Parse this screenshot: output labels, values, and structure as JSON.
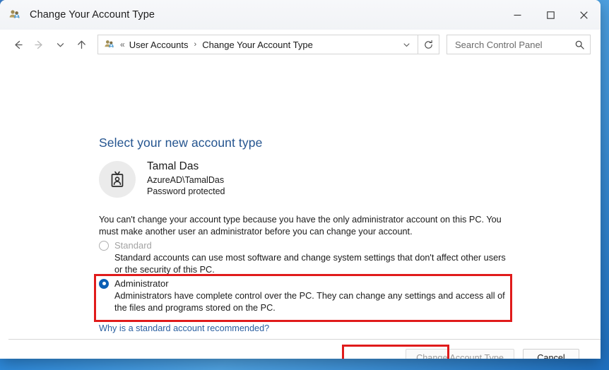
{
  "window": {
    "title": "Change Your Account Type",
    "icon": "user-accounts-icon",
    "controls": {
      "minimize": "─",
      "maximize": "□",
      "close": "✕"
    }
  },
  "navbar": {
    "back_icon": "back-arrow-icon",
    "forward_icon": "forward-arrow-icon",
    "recent_icon": "chevron-down-icon",
    "up_icon": "up-arrow-icon",
    "refresh_icon": "refresh-icon",
    "breadcrumb": {
      "icon": "user-accounts-icon",
      "prefix": "«",
      "items": [
        "User Accounts",
        "Change Your Account Type"
      ],
      "separator": "›"
    },
    "dropdown_icon": "chevron-down-icon"
  },
  "search": {
    "placeholder": "Search Control Panel",
    "value": "",
    "icon": "search-icon"
  },
  "main": {
    "heading": "Select your new account type",
    "account": {
      "avatar_icon": "id-badge-icon",
      "name": "Tamal Das",
      "domain": "AzureAD\\TamalDas",
      "status": "Password protected"
    },
    "warning": "You can't change your account type because you have the only administrator account on this PC. You must make another user an administrator before you can change your account.",
    "options": [
      {
        "id": "standard",
        "label": "Standard",
        "description": "Standard accounts can use most software and change system settings that don't affect other users or the security of this PC.",
        "selected": false,
        "disabled": true
      },
      {
        "id": "administrator",
        "label": "Administrator",
        "description": "Administrators have complete control over the PC. They can change any settings and access all of the files and programs stored on the PC.",
        "selected": true,
        "disabled": false
      }
    ],
    "help_link": "Why is a standard account recommended?"
  },
  "footer": {
    "primary_button": "Change Account Type",
    "primary_disabled": true,
    "cancel_button": "Cancel"
  },
  "annotations": {
    "accent_color": "#e01b1b",
    "highlight_admin_option": true,
    "highlight_primary_button": true
  }
}
